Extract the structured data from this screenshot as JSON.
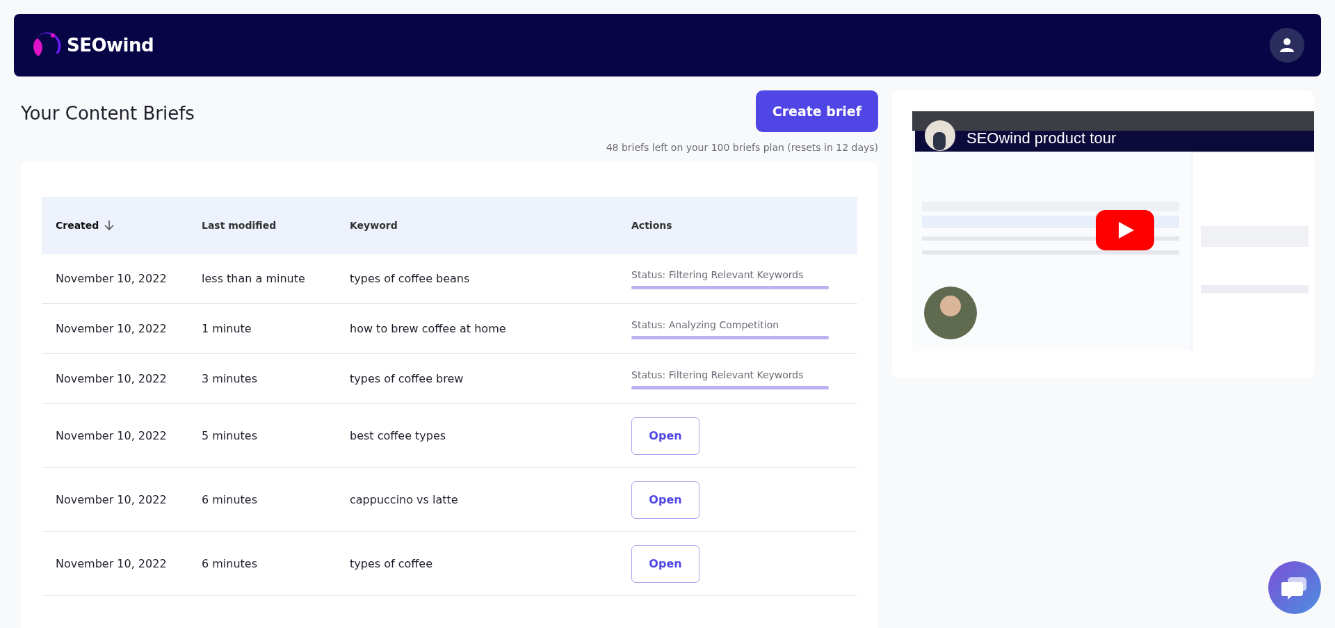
{
  "header": {
    "logo_text": "SEOwind"
  },
  "page": {
    "title": "Your Content Briefs",
    "create_button": "Create brief",
    "plan_note": "48 briefs left on your 100 briefs plan (resets in 12 days)"
  },
  "table": {
    "columns": [
      {
        "label": "Created",
        "sorted": true
      },
      {
        "label": "Last modified",
        "sorted": false
      },
      {
        "label": "Keyword",
        "sorted": false
      },
      {
        "label": "Actions",
        "sorted": false
      }
    ],
    "rows": [
      {
        "created": "November 10, 2022",
        "modified": "less than a minute",
        "keyword": "types of coffee beans",
        "kind": "status",
        "status": "Status: Filtering Relevant Keywords",
        "level": 1
      },
      {
        "created": "November 10, 2022",
        "modified": "1 minute",
        "keyword": "how to brew coffee at home",
        "kind": "status",
        "status": "Status: Analyzing Competition",
        "level": 1
      },
      {
        "created": "November 10, 2022",
        "modified": "3 minutes",
        "keyword": "types of coffee brew",
        "kind": "status",
        "status": "Status: Filtering Relevant Keywords",
        "level": 1
      },
      {
        "created": "November 10, 2022",
        "modified": "5 minutes",
        "keyword": "best coffee types",
        "kind": "open",
        "action": "Open"
      },
      {
        "created": "November 10, 2022",
        "modified": "6 minutes",
        "keyword": "cappuccino vs latte",
        "kind": "open",
        "action": "Open"
      },
      {
        "created": "November 10, 2022",
        "modified": "6 minutes",
        "keyword": "types of coffee",
        "kind": "open",
        "action": "Open"
      }
    ]
  },
  "video": {
    "title": "SEOwind product tour"
  }
}
